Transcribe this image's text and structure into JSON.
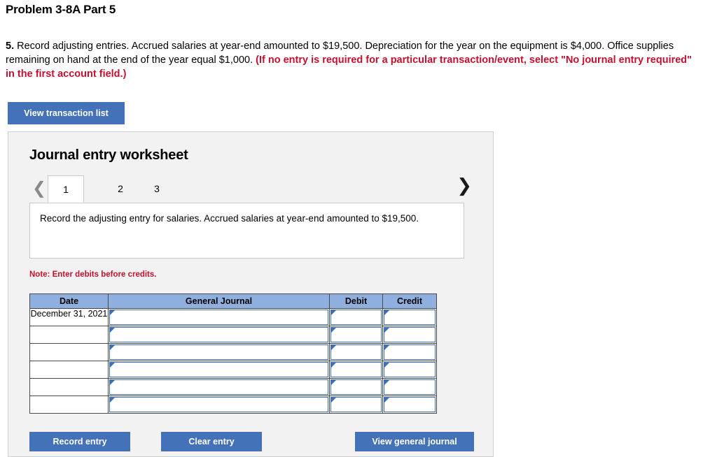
{
  "problem": {
    "title": "Problem 3-8A Part 5"
  },
  "instructions": {
    "number": "5.",
    "text_main": " Record adjusting entries. Accrued salaries at year-end amounted to $19,500. Depreciation for the year on the equipment is $4,000. Office supplies remaining on hand at the end of the year equal $1,000. ",
    "text_red": "(If no entry is required for a particular transaction/event, select \"No journal entry required\" in the first account field.)"
  },
  "buttons": {
    "view_transaction_list": "View transaction list",
    "record_entry": "Record entry",
    "clear_entry": "Clear entry",
    "view_general_journal": "View general journal"
  },
  "worksheet": {
    "title": "Journal entry worksheet",
    "tabs": [
      {
        "label": "1",
        "active": true
      },
      {
        "label": "2",
        "active": false
      },
      {
        "label": "3",
        "active": false
      }
    ],
    "prev_icon": "chevron-left-icon",
    "next_icon": "chevron-right-icon",
    "description": "Record the adjusting entry for salaries. Accrued salaries at year-end amounted to $19,500.",
    "note": "Note: Enter debits before credits."
  },
  "journal_table": {
    "headers": [
      "Date",
      "General Journal",
      "Debit",
      "Credit"
    ],
    "rows": [
      {
        "date": "December 31, 2021",
        "general_journal": "",
        "debit": "",
        "credit": ""
      },
      {
        "date": "",
        "general_journal": "",
        "debit": "",
        "credit": ""
      },
      {
        "date": "",
        "general_journal": "",
        "debit": "",
        "credit": ""
      },
      {
        "date": "",
        "general_journal": "",
        "debit": "",
        "credit": ""
      },
      {
        "date": "",
        "general_journal": "",
        "debit": "",
        "credit": ""
      },
      {
        "date": "",
        "general_journal": "",
        "debit": "",
        "credit": ""
      }
    ]
  },
  "colors": {
    "button_blue": "#4472b8",
    "header_blue": "#8fb0de",
    "warning_red": "#c4112f",
    "panel_gray": "#f2f2f2"
  }
}
